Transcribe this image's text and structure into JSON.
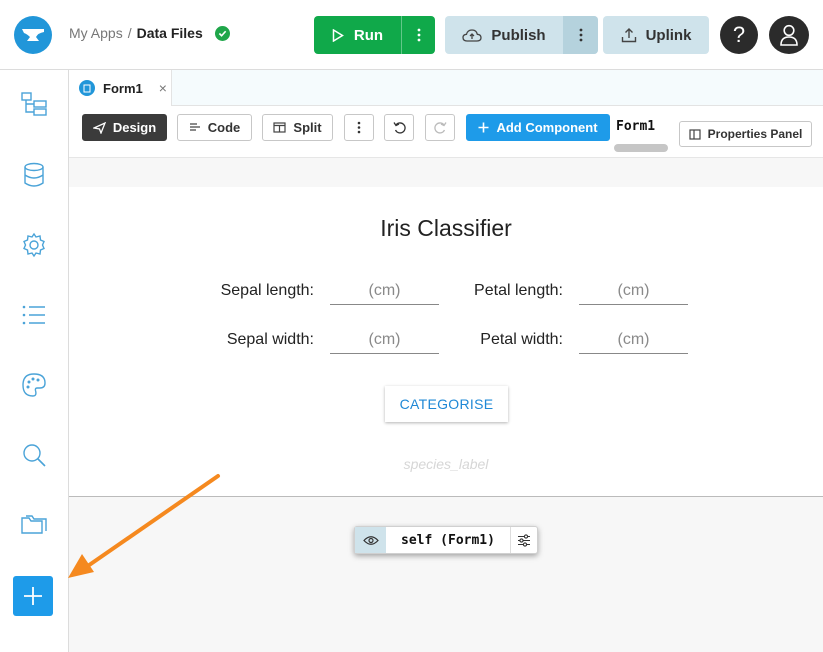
{
  "header": {
    "breadcrumb_parent": "My Apps",
    "breadcrumb_separator": "/",
    "app_name": "Data Files",
    "run_label": "Run",
    "publish_label": "Publish",
    "uplink_label": "Uplink",
    "help_label": "?"
  },
  "tabs": [
    {
      "label": "Form1",
      "close": "×"
    }
  ],
  "toolbar": {
    "design_label": "Design",
    "code_label": "Code",
    "split_label": "Split",
    "add_component_label": "Add Component",
    "form_name": "Form1",
    "properties_panel_label": "Properties Panel"
  },
  "form": {
    "title": "Iris Classifier",
    "fields": [
      {
        "label": "Sepal length:",
        "placeholder": "(cm)"
      },
      {
        "label": "Petal length:",
        "placeholder": "(cm)"
      },
      {
        "label": "Sepal width:",
        "placeholder": "(cm)"
      },
      {
        "label": "Petal width:",
        "placeholder": "(cm)"
      }
    ],
    "button_label": "CATEGORISE",
    "species_label": "species_label"
  },
  "selector": {
    "name": "self (Form1)"
  },
  "colors": {
    "brand_blue": "#1e9be9",
    "run_green": "#10a94a",
    "publish_bg": "#cfe3eb",
    "arrow_orange": "#f5891f"
  },
  "icons": {
    "sidebar": [
      "app-tree-icon",
      "database-icon",
      "settings-icon",
      "list-icon",
      "palette-icon",
      "search-icon",
      "folder-icon",
      "plus-icon"
    ]
  }
}
